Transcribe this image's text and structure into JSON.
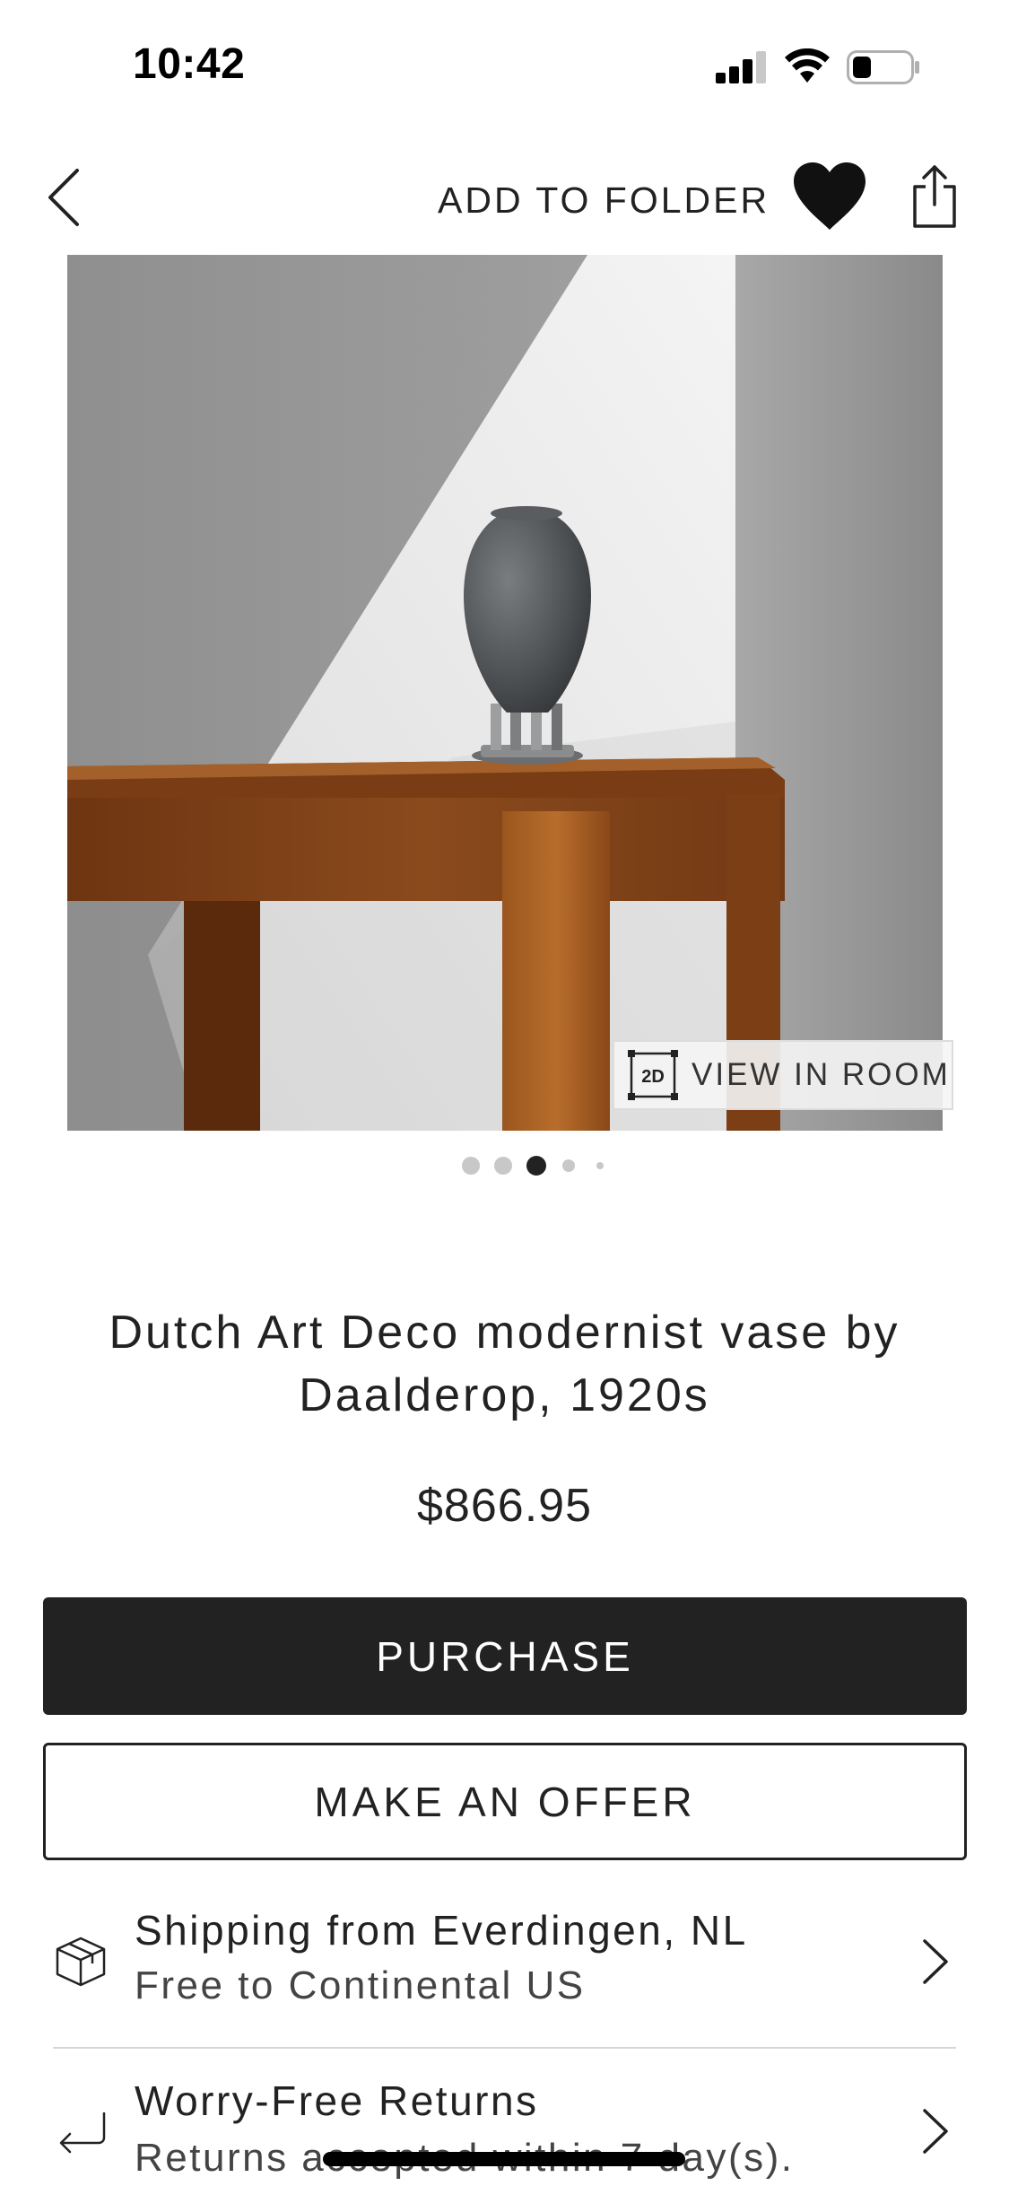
{
  "status_bar": {
    "time": "10:42",
    "icons": [
      "signal-icon",
      "wifi-icon",
      "battery-icon"
    ]
  },
  "nav": {
    "back_icon": "chevron-left-icon",
    "add_to_folder_label": "ADD TO FOLDER",
    "favorite_icon": "heart-filled-icon",
    "share_icon": "share-icon"
  },
  "gallery": {
    "view_in_room_badge": "2D",
    "view_in_room_label": "VIEW IN ROOM",
    "page_count": 5,
    "active_page_index": 2
  },
  "product": {
    "title": "Dutch Art Deco modernist vase by Daalderop, 1920s",
    "price": "$866.95"
  },
  "actions": {
    "purchase_label": "PURCHASE",
    "offer_label": "MAKE AN OFFER"
  },
  "info_rows": [
    {
      "icon": "package-box-icon",
      "title": "Shipping from Everdingen, NL",
      "subtitle": "Free to Continental US"
    },
    {
      "icon": "return-arrow-icon",
      "title": "Worry-Free Returns",
      "subtitle": "Returns accepted within 7 day(s)."
    }
  ],
  "colors": {
    "primary_button": "#222222",
    "text": "#222222",
    "background": "#ffffff"
  }
}
